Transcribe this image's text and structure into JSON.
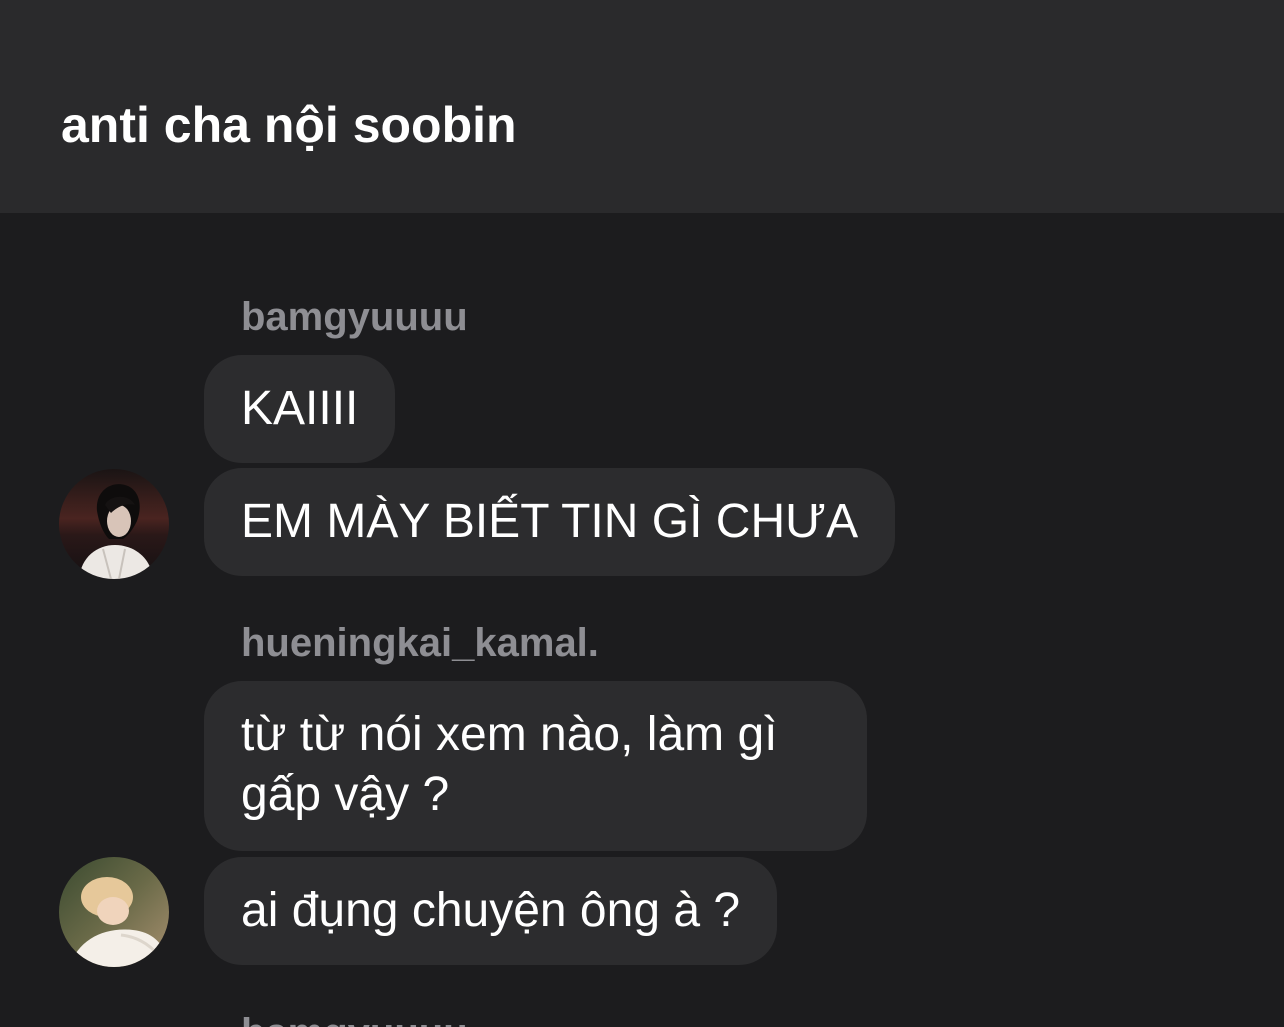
{
  "header": {
    "title": "anti cha nội soobin"
  },
  "messages": [
    {
      "sender": "bamgyuuuu",
      "bubbles": [
        "KAIIII",
        "EM MÀY BIẾT TIN GÌ CHƯA"
      ]
    },
    {
      "sender": "hueningkai_kamal.",
      "bubbles": [
        "từ từ nói xem nào, làm gì gấp vậy ?",
        "ai đụng chuyện ông à ?"
      ]
    },
    {
      "sender": "bamgyuuuu"
    }
  ],
  "colors": {
    "header_bg": "#2a2a2c",
    "chat_bg": "#1c1c1e",
    "bubble_bg": "#2c2c2e",
    "sender_text": "#8e8e93",
    "message_text": "#ffffff"
  }
}
